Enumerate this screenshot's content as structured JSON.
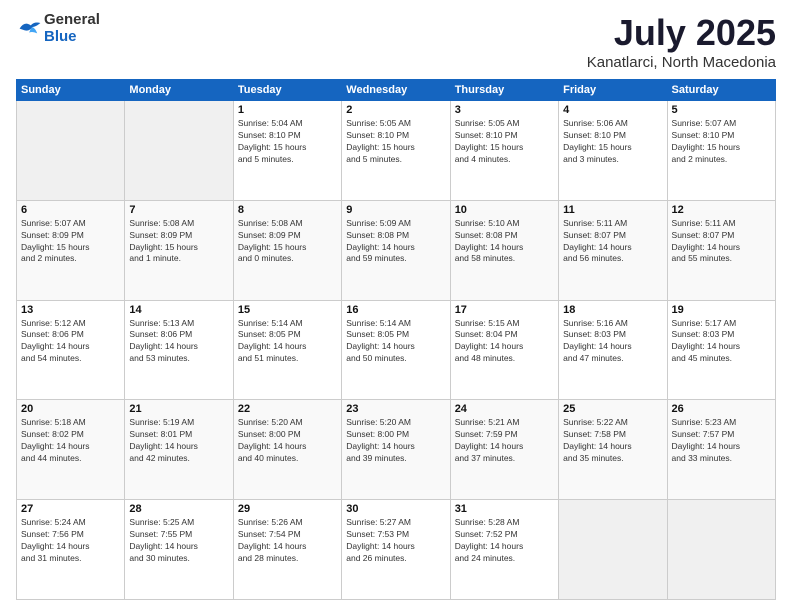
{
  "header": {
    "logo_general": "General",
    "logo_blue": "Blue",
    "title": "July 2025",
    "location": "Kanatlarci, North Macedonia"
  },
  "weekdays": [
    "Sunday",
    "Monday",
    "Tuesday",
    "Wednesday",
    "Thursday",
    "Friday",
    "Saturday"
  ],
  "weeks": [
    [
      {
        "day": "",
        "info": ""
      },
      {
        "day": "",
        "info": ""
      },
      {
        "day": "1",
        "info": "Sunrise: 5:04 AM\nSunset: 8:10 PM\nDaylight: 15 hours\nand 5 minutes."
      },
      {
        "day": "2",
        "info": "Sunrise: 5:05 AM\nSunset: 8:10 PM\nDaylight: 15 hours\nand 5 minutes."
      },
      {
        "day": "3",
        "info": "Sunrise: 5:05 AM\nSunset: 8:10 PM\nDaylight: 15 hours\nand 4 minutes."
      },
      {
        "day": "4",
        "info": "Sunrise: 5:06 AM\nSunset: 8:10 PM\nDaylight: 15 hours\nand 3 minutes."
      },
      {
        "day": "5",
        "info": "Sunrise: 5:07 AM\nSunset: 8:10 PM\nDaylight: 15 hours\nand 2 minutes."
      }
    ],
    [
      {
        "day": "6",
        "info": "Sunrise: 5:07 AM\nSunset: 8:09 PM\nDaylight: 15 hours\nand 2 minutes."
      },
      {
        "day": "7",
        "info": "Sunrise: 5:08 AM\nSunset: 8:09 PM\nDaylight: 15 hours\nand 1 minute."
      },
      {
        "day": "8",
        "info": "Sunrise: 5:08 AM\nSunset: 8:09 PM\nDaylight: 15 hours\nand 0 minutes."
      },
      {
        "day": "9",
        "info": "Sunrise: 5:09 AM\nSunset: 8:08 PM\nDaylight: 14 hours\nand 59 minutes."
      },
      {
        "day": "10",
        "info": "Sunrise: 5:10 AM\nSunset: 8:08 PM\nDaylight: 14 hours\nand 58 minutes."
      },
      {
        "day": "11",
        "info": "Sunrise: 5:11 AM\nSunset: 8:07 PM\nDaylight: 14 hours\nand 56 minutes."
      },
      {
        "day": "12",
        "info": "Sunrise: 5:11 AM\nSunset: 8:07 PM\nDaylight: 14 hours\nand 55 minutes."
      }
    ],
    [
      {
        "day": "13",
        "info": "Sunrise: 5:12 AM\nSunset: 8:06 PM\nDaylight: 14 hours\nand 54 minutes."
      },
      {
        "day": "14",
        "info": "Sunrise: 5:13 AM\nSunset: 8:06 PM\nDaylight: 14 hours\nand 53 minutes."
      },
      {
        "day": "15",
        "info": "Sunrise: 5:14 AM\nSunset: 8:05 PM\nDaylight: 14 hours\nand 51 minutes."
      },
      {
        "day": "16",
        "info": "Sunrise: 5:14 AM\nSunset: 8:05 PM\nDaylight: 14 hours\nand 50 minutes."
      },
      {
        "day": "17",
        "info": "Sunrise: 5:15 AM\nSunset: 8:04 PM\nDaylight: 14 hours\nand 48 minutes."
      },
      {
        "day": "18",
        "info": "Sunrise: 5:16 AM\nSunset: 8:03 PM\nDaylight: 14 hours\nand 47 minutes."
      },
      {
        "day": "19",
        "info": "Sunrise: 5:17 AM\nSunset: 8:03 PM\nDaylight: 14 hours\nand 45 minutes."
      }
    ],
    [
      {
        "day": "20",
        "info": "Sunrise: 5:18 AM\nSunset: 8:02 PM\nDaylight: 14 hours\nand 44 minutes."
      },
      {
        "day": "21",
        "info": "Sunrise: 5:19 AM\nSunset: 8:01 PM\nDaylight: 14 hours\nand 42 minutes."
      },
      {
        "day": "22",
        "info": "Sunrise: 5:20 AM\nSunset: 8:00 PM\nDaylight: 14 hours\nand 40 minutes."
      },
      {
        "day": "23",
        "info": "Sunrise: 5:20 AM\nSunset: 8:00 PM\nDaylight: 14 hours\nand 39 minutes."
      },
      {
        "day": "24",
        "info": "Sunrise: 5:21 AM\nSunset: 7:59 PM\nDaylight: 14 hours\nand 37 minutes."
      },
      {
        "day": "25",
        "info": "Sunrise: 5:22 AM\nSunset: 7:58 PM\nDaylight: 14 hours\nand 35 minutes."
      },
      {
        "day": "26",
        "info": "Sunrise: 5:23 AM\nSunset: 7:57 PM\nDaylight: 14 hours\nand 33 minutes."
      }
    ],
    [
      {
        "day": "27",
        "info": "Sunrise: 5:24 AM\nSunset: 7:56 PM\nDaylight: 14 hours\nand 31 minutes."
      },
      {
        "day": "28",
        "info": "Sunrise: 5:25 AM\nSunset: 7:55 PM\nDaylight: 14 hours\nand 30 minutes."
      },
      {
        "day": "29",
        "info": "Sunrise: 5:26 AM\nSunset: 7:54 PM\nDaylight: 14 hours\nand 28 minutes."
      },
      {
        "day": "30",
        "info": "Sunrise: 5:27 AM\nSunset: 7:53 PM\nDaylight: 14 hours\nand 26 minutes."
      },
      {
        "day": "31",
        "info": "Sunrise: 5:28 AM\nSunset: 7:52 PM\nDaylight: 14 hours\nand 24 minutes."
      },
      {
        "day": "",
        "info": ""
      },
      {
        "day": "",
        "info": ""
      }
    ]
  ]
}
